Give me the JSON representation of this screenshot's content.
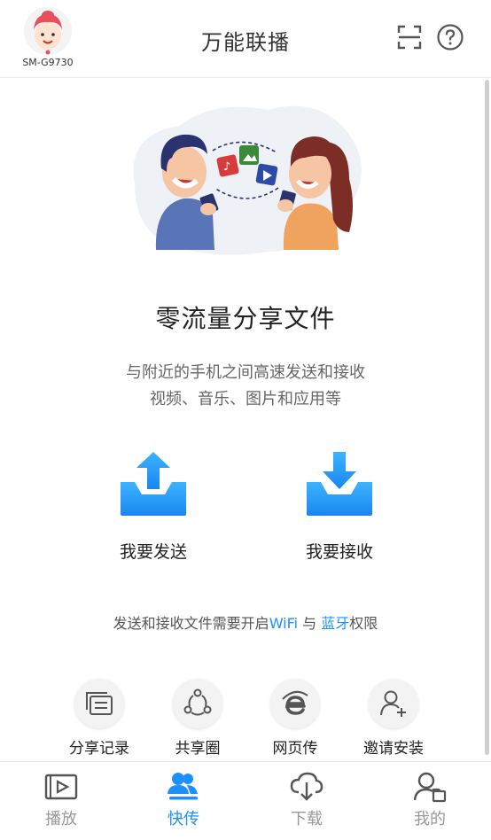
{
  "header": {
    "device_name": "SM-G9730",
    "title": "万能联播"
  },
  "hero": {
    "title": "零流量分享文件",
    "subtitle_line1": "与附近的手机之间高速发送和接收",
    "subtitle_line2": "视频、音乐、图片和应用等"
  },
  "actions": {
    "send_label": "我要发送",
    "receive_label": "我要接收"
  },
  "permission": {
    "prefix": "发送和接收文件需要开启",
    "wifi": "WiFi",
    "middle": " 与 ",
    "bluetooth": "蓝牙",
    "suffix": "权限"
  },
  "tools": [
    {
      "label": "分享记录",
      "icon": "history-icon"
    },
    {
      "label": "共享圈",
      "icon": "share-circle-icon"
    },
    {
      "label": "网页传",
      "icon": "web-transfer-icon"
    },
    {
      "label": "邀请安装",
      "icon": "invite-user-icon"
    }
  ],
  "nav": [
    {
      "label": "播放",
      "icon": "play-icon",
      "active": false
    },
    {
      "label": "快传",
      "icon": "transfer-icon",
      "active": true
    },
    {
      "label": "下载",
      "icon": "download-icon",
      "active": false
    },
    {
      "label": "我的",
      "icon": "profile-icon",
      "active": false
    }
  ],
  "colors": {
    "accent": "#1e8fff",
    "inactive": "#999999"
  }
}
